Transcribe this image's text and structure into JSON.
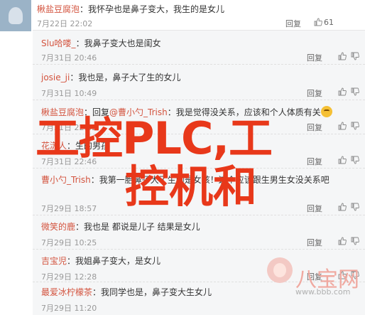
{
  "top_comment": {
    "username": "楸盐豆腐泡",
    "text": "我怀孕也是鼻子变大，我生的是女儿",
    "time": "7月22日 22:02",
    "likes": "61"
  },
  "reply_label": "回复",
  "replies": [
    {
      "username": "Slu哈喽_",
      "text": "我鼻子变大也是闺女",
      "time": "7月31日 20:46"
    },
    {
      "username": "josie_ji",
      "text": "我也是，鼻子大了生的女儿",
      "time": "7月31日 10:49",
      "tag": "★"
    },
    {
      "username": "楸盐豆腐泡",
      "reply_prefix": "回复",
      "reply_to": "@曹小勺_Trish",
      "text": "我是觉得没关系，应该和个人体质有关",
      "time": "7月31日 22:02",
      "emoji": "embarrassed-face"
    },
    {
      "username": "花漾人",
      "text": "生的男孩",
      "time": "7月31日 22:46"
    },
    {
      "username": "曹小勺_Trish",
      "text": "我第一胎鼻子大了生的是女孩！这个应该跟生男生女没关系吧",
      "time": "7月29日 18:57"
    },
    {
      "username": "微笑的鹿",
      "text": "我也是 都说是儿子 结果是女儿",
      "time": "7月29日 10:25"
    },
    {
      "username": "吉宝児",
      "text": "我姐鼻子变大，是女儿",
      "time": "7月29日 12:28"
    },
    {
      "username": "最爱冰柠檬茶",
      "text": "我同学也是，鼻子变大生女儿",
      "time": "7月29日 11:20"
    }
  ],
  "watermark": {
    "line1": "工控PLC,工",
    "line2": "控机和"
  },
  "logo": {
    "text": "八宝网",
    "url": "www.bbb.com"
  },
  "colors": {
    "username": "#d3533e",
    "watermark": "#e8381a",
    "reply_bg": "#f5f6f7"
  }
}
